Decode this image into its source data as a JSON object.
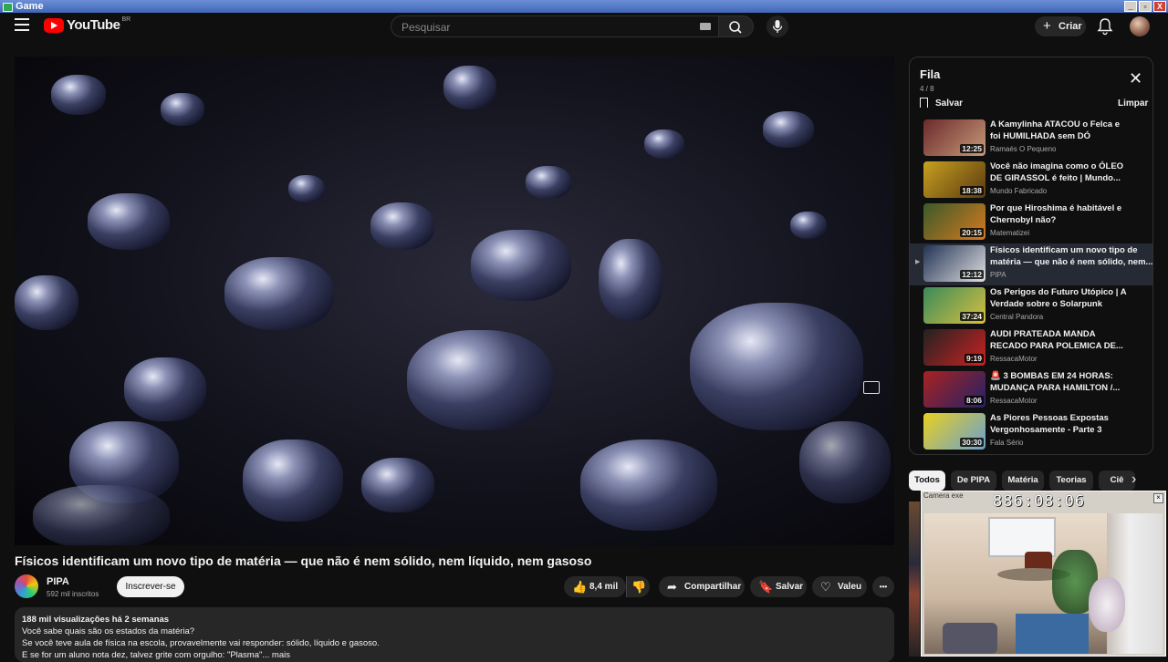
{
  "window": {
    "title": "Game",
    "buttons": [
      "_",
      "▫",
      "X"
    ]
  },
  "header": {
    "logo_text": "YouTube",
    "country_code": "BR",
    "search_placeholder": "Pesquisar",
    "create_label": "Criar",
    "create_icon": "+"
  },
  "video": {
    "title": "Físicos identificam um novo tipo de matéria — que não é nem sólido, nem líquido, nem gasoso",
    "channel": "PIPA",
    "subscribers": "592 mil inscritos",
    "subscribe_label": "Inscrever-se",
    "likes": "8,4 mil",
    "share_label": "Compartilhar",
    "save_label": "Salvar",
    "thanks_label": "Valeu",
    "more_label": "•••",
    "icons": {
      "like": "👍",
      "dislike": "👎",
      "share": "➦",
      "save": "🔖",
      "thanks": "♡"
    }
  },
  "description": {
    "stats": "188 mil visualizações  há 2 semanas",
    "line1": "Você sabe quais são os estados da matéria?",
    "line2": "Se você teve aula de física na escola, provavelmente vai responder: sólido, líquido e gasoso.",
    "line3": "E se for um aluno nota dez, talvez grite com orgulho: \"Plasma\"... mais"
  },
  "queue": {
    "title": "Fila",
    "count": "4 / 8",
    "save_label": "Salvar",
    "clear_label": "Limpar",
    "close_icon": "✕",
    "current_indicator": "▶",
    "items": [
      {
        "title1": "A Kamylinha ATACOU o Felca e",
        "title2": "foi HUMILHADA sem DÓ",
        "channel": "Ramaés O Pequeno",
        "duration": "12:25",
        "colors": [
          "#6a2a2a",
          "#c89a7a"
        ]
      },
      {
        "title1": "Você não imagina como o ÓLEO",
        "title2": "DE GIRASSOL é feito | Mundo...",
        "channel": "Mundo Fabricado",
        "duration": "18:38",
        "colors": [
          "#c8a020",
          "#5a3a10"
        ]
      },
      {
        "title1": "Por que Hiroshima é habitável e",
        "title2": "Chernobyl não?",
        "channel": "Matematizei",
        "duration": "20:15",
        "colors": [
          "#3a5a2a",
          "#d87a20"
        ]
      },
      {
        "title1": "Físicos identificam um novo tipo de",
        "title2": "matéria — que não é nem sólido, nem...",
        "channel": "PIPA",
        "duration": "12:12",
        "colors": [
          "#223355",
          "#e0e0e0"
        ],
        "active": true
      },
      {
        "title1": "Os Perigos do Futuro Utópico | A",
        "title2": "Verdade sobre o Solarpunk",
        "channel": "Central Pandora",
        "duration": "37:24",
        "colors": [
          "#3a8a5a",
          "#d8c040"
        ]
      },
      {
        "title1": "AUDI PRATEADA MANDA",
        "title2": "RECADO PARA POLEMICA DE...",
        "channel": "RessacaMotor",
        "duration": "9:19",
        "colors": [
          "#222222",
          "#cc2222"
        ]
      },
      {
        "title1": "🚨 3 BOMBAS EM 24 HORAS:",
        "title2": "MUDANÇA PARA HAMILTON /...",
        "channel": "RessacaMotor",
        "duration": "8:06",
        "colors": [
          "#aa2222",
          "#222266"
        ]
      },
      {
        "title1": "As Piores Pessoas Expostas",
        "title2": "Vergonhosamente - Parte 3",
        "channel": "Fala Sério",
        "duration": "30:30",
        "colors": [
          "#e8d020",
          "#6aa0d0"
        ]
      }
    ]
  },
  "chips": [
    "Todos",
    "De PIPA",
    "Matéria",
    "Teorias",
    "Ciê"
  ],
  "camera_widget": {
    "title": "Camera exe",
    "clock": "886:08:06",
    "close": "×"
  }
}
